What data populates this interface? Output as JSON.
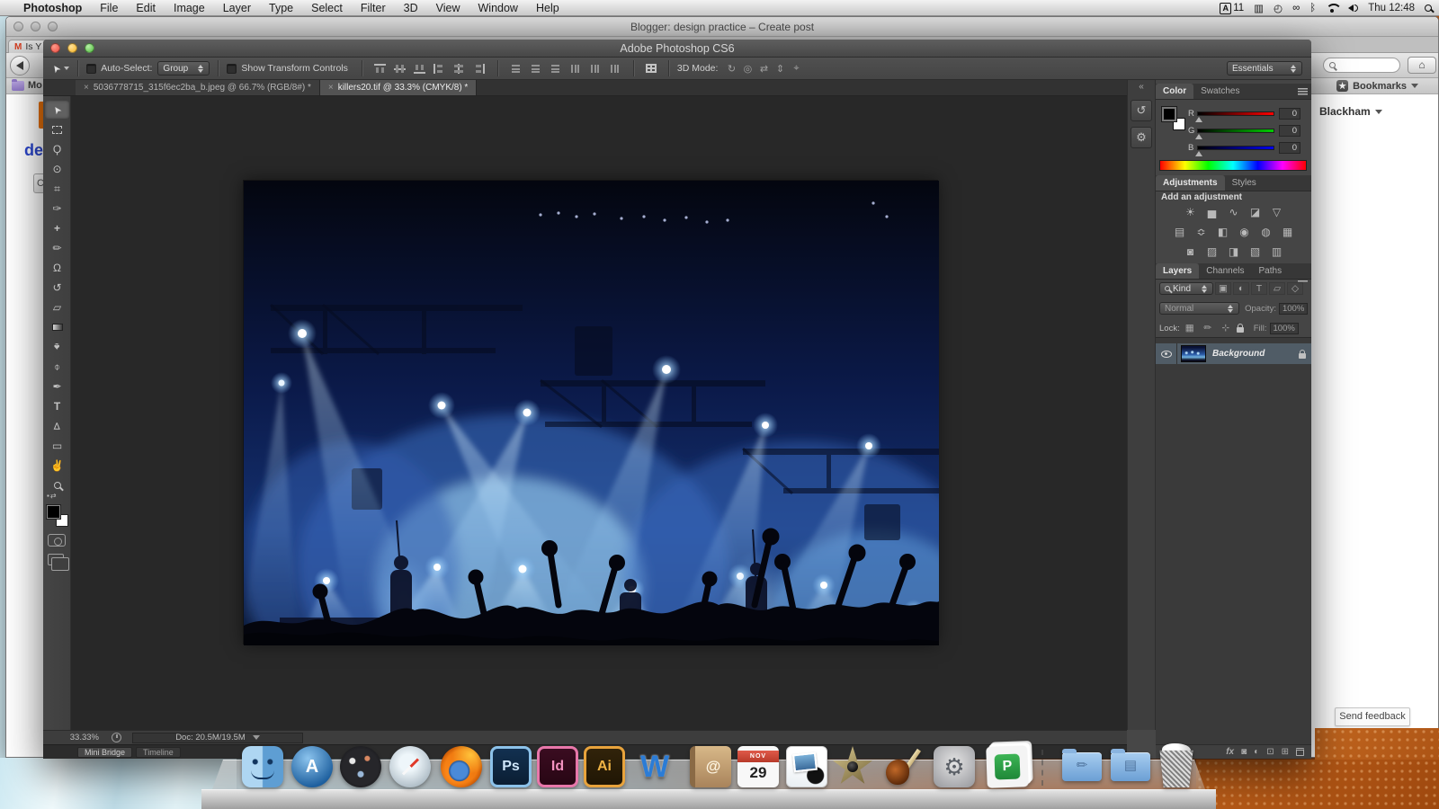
{
  "menu_bar": {
    "items": [
      "Photoshop",
      "File",
      "Edit",
      "Image",
      "Layer",
      "Type",
      "Select",
      "Filter",
      "3D",
      "View",
      "Window",
      "Help"
    ],
    "input_icon": "A",
    "input_badge": "11",
    "icon_glyphs": {
      "keyboard_viewer": "▥",
      "time_machine": "◴",
      "binoculars": "∞",
      "bluetooth": "ᛒ"
    },
    "clock": "Thu 12:48"
  },
  "browser": {
    "title": "Blogger: design practice – Create post",
    "tab_favicon": "M",
    "tab_fragment": "Is Y",
    "bookmarks_folder_fragment": "Mo",
    "page_heading_fragment": "de",
    "page_button_fragment": "C",
    "home_glyph": "⌂",
    "bookmarks_label": "Bookmarks",
    "account_name": "Blackham",
    "send_feedback_label": "Send feedback"
  },
  "photoshop": {
    "window_title": "Adobe Photoshop CS6",
    "close_glyph": "×",
    "options": {
      "auto_select_label": "Auto-Select:",
      "auto_select_value": "Group",
      "show_transform_label": "Show Transform Controls",
      "mode_3d_label": "3D Mode:",
      "workspace": "Essentials"
    },
    "mode_3d_icons": [
      "↻",
      "◎",
      "⇄",
      "⇕",
      "⌖"
    ],
    "align_icon_names": [
      "align-top-edges",
      "align-vertical-centers",
      "align-bottom-edges",
      "align-left-edges",
      "align-horizontal-centers",
      "align-right-edges",
      "distribute-top-edges",
      "distribute-vertical-centers",
      "distribute-bottom-edges",
      "distribute-left-edges",
      "distribute-horizontal-centers",
      "distribute-right-edges",
      "auto-align-layers"
    ],
    "tabs": [
      {
        "label": "5036778715_315f6ec2ba_b.jpeg @ 66.7% (RGB/8#) *"
      },
      {
        "label": "killers20.tif @ 33.3% (CMYK/8) *"
      }
    ],
    "tools": [
      {
        "name": "move",
        "glyph": "➤"
      },
      {
        "name": "rectangular-marquee",
        "glyph": ""
      },
      {
        "name": "lasso",
        "glyph": "Ϙ"
      },
      {
        "name": "quick-selection",
        "glyph": "⊙"
      },
      {
        "name": "crop",
        "glyph": "⌗"
      },
      {
        "name": "eyedropper",
        "glyph": "✑"
      },
      {
        "name": "spot-healing-brush",
        "glyph": "+"
      },
      {
        "name": "brush",
        "glyph": "✏"
      },
      {
        "name": "clone-stamp",
        "glyph": "Ω"
      },
      {
        "name": "history-brush",
        "glyph": "↺"
      },
      {
        "name": "eraser",
        "glyph": "▱"
      },
      {
        "name": "gradient",
        "glyph": ""
      },
      {
        "name": "blur",
        "glyph": "♠"
      },
      {
        "name": "dodge",
        "glyph": "⌽"
      },
      {
        "name": "pen",
        "glyph": "✒"
      },
      {
        "name": "type",
        "glyph": "T"
      },
      {
        "name": "path-selection",
        "glyph": "⊳"
      },
      {
        "name": "rectangle",
        "glyph": "▭"
      },
      {
        "name": "hand",
        "glyph": "✌"
      },
      {
        "name": "zoom",
        "glyph": ""
      }
    ],
    "collapse_glyph": "«",
    "collapsed_icons": [
      {
        "name": "history",
        "glyph": "↺"
      },
      {
        "name": "tool-presets",
        "glyph": "⚙"
      }
    ],
    "color_panel": {
      "tab_color": "Color",
      "tab_swatches": "Swatches",
      "channels": [
        {
          "label": "R",
          "value": "0"
        },
        {
          "label": "G",
          "value": "0"
        },
        {
          "label": "B",
          "value": "0"
        }
      ]
    },
    "adjustments_panel": {
      "tab_adjustments": "Adjustments",
      "tab_styles": "Styles",
      "heading": "Add an adjustment",
      "icons": [
        "☀",
        "▅",
        "∿",
        "◪",
        "▽",
        "▤",
        "≎",
        "◧",
        "◉",
        "◍",
        "▦",
        "◙",
        "▨",
        "◨",
        "▧",
        "▥"
      ]
    },
    "layers_panel": {
      "tab_layers": "Layers",
      "tab_channels": "Channels",
      "tab_paths": "Paths",
      "kind_label": "Kind",
      "filter_icons": [
        "▣",
        "◐",
        "T",
        "▱",
        "◇"
      ],
      "blend_mode": "Normal",
      "opacity_label": "Opacity:",
      "opacity_value": "100%",
      "lock_label": "Lock:",
      "lock_icons": [
        "▦",
        "✏",
        "⊹"
      ],
      "fill_label": "Fill:",
      "fill_value": "100%",
      "layer_name": "Background",
      "bottom_icons": [
        {
          "name": "layer-style",
          "glyph": "fx"
        },
        {
          "name": "layer-mask",
          "glyph": "◙"
        },
        {
          "name": "new-adjustment-layer",
          "glyph": "◐"
        },
        {
          "name": "new-group",
          "glyph": "⊡"
        },
        {
          "name": "new-layer",
          "glyph": "⊞"
        },
        {
          "name": "delete-layer",
          "glyph": ""
        }
      ]
    },
    "status": {
      "zoom": "33.33%",
      "doc": "Doc: 20.5M/19.5M"
    },
    "bottom_tabs": {
      "mini_bridge": "Mini Bridge",
      "timeline": "Timeline"
    }
  },
  "dock": {
    "items": [
      {
        "name": "finder",
        "label": ""
      },
      {
        "name": "app-store",
        "label": "A"
      },
      {
        "name": "dashboard",
        "label": ""
      },
      {
        "name": "safari",
        "label": ""
      },
      {
        "name": "firefox",
        "label": ""
      },
      {
        "name": "photoshop",
        "label": "Ps"
      },
      {
        "name": "indesign",
        "label": "Id"
      },
      {
        "name": "illustrator",
        "label": "Ai"
      },
      {
        "name": "word",
        "label": "W"
      },
      {
        "name": "contacts",
        "label": "@"
      },
      {
        "name": "calendar",
        "label": "29",
        "sublabel": "NOV"
      },
      {
        "name": "photo-booth",
        "label": ""
      },
      {
        "name": "imovie",
        "label": ""
      },
      {
        "name": "garageband",
        "label": ""
      },
      {
        "name": "system-preferences",
        "label": "⚙"
      },
      {
        "name": "publisher",
        "label": "P"
      },
      {
        "name": "applications-folder",
        "label": "✏"
      },
      {
        "name": "documents-folder",
        "label": "▤"
      },
      {
        "name": "trash",
        "label": ""
      }
    ]
  },
  "colors": {
    "ps_chrome": "#474747",
    "ps_canvas": "#282828",
    "selected_layer_row": "#505c66",
    "menu_bar_bg": "#d8d8d8",
    "heading_blue": "#2b46cc",
    "blogger_orange": "#e8710a",
    "stage_light_blue": "#9fd4f2"
  }
}
